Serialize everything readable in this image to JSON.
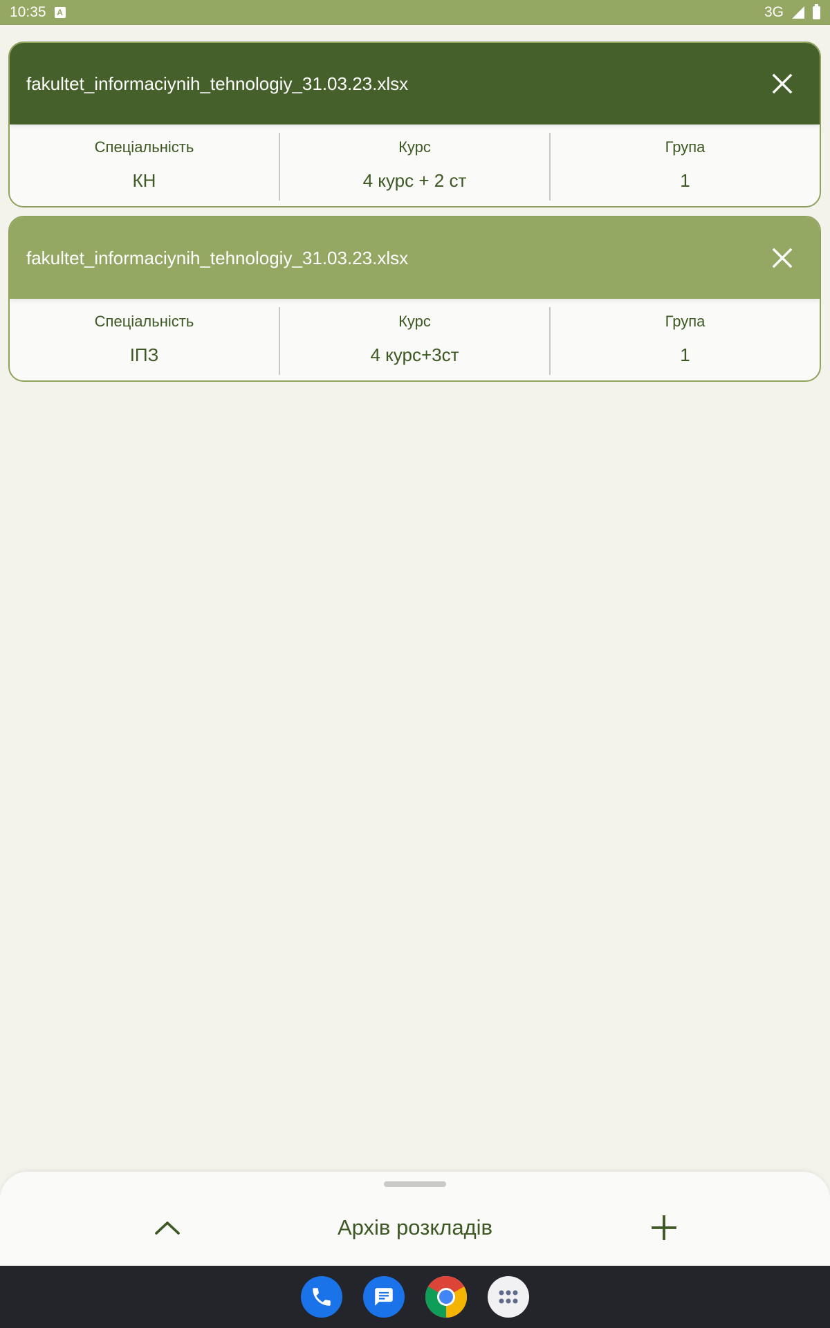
{
  "status_bar": {
    "time": "10:35",
    "network": "3G",
    "icons": [
      "a-notification-icon",
      "signal-icon",
      "battery-icon"
    ]
  },
  "schedules": [
    {
      "file_name": "fakultet_informaciynih_tehnologiy_31.03.23.xlsx",
      "header_color": "#45602a",
      "specialty_label": "Спеціальність",
      "specialty_value": "КН",
      "course_label": "Курс",
      "course_value": "4 курс + 2 ст",
      "group_label": "Група",
      "group_value": "1"
    },
    {
      "file_name": "fakultet_informaciynih_tehnologiy_31.03.23.xlsx",
      "header_color": "#95a863",
      "specialty_label": "Спеціальність",
      "specialty_value": "ІПЗ",
      "course_label": "Курс",
      "course_value": "4 курс+3ст",
      "group_label": "Група",
      "group_value": "1"
    }
  ],
  "bottom_sheet": {
    "title": "Архів розкладів"
  },
  "dock": {
    "apps": [
      "phone-icon",
      "messages-icon",
      "chrome-icon",
      "app-drawer-icon"
    ]
  },
  "colors": {
    "accent_dark": "#45602a",
    "accent_light": "#95a863",
    "text": "#3d5822",
    "background": "#f3f2eb"
  }
}
